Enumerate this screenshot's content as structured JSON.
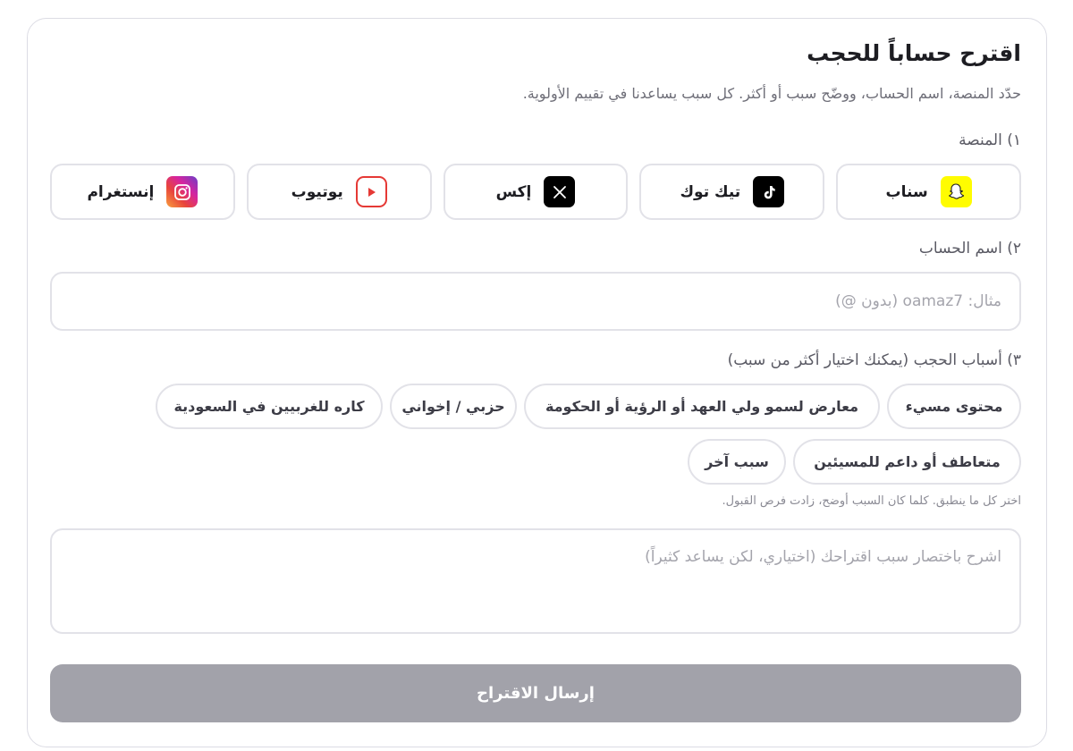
{
  "form": {
    "title": "اقترح حساباً للحجب",
    "subtitle": "حدّد المنصة، اسم الحساب، ووضّح سبب أو أكثر. كل سبب يساعدنا في تقييم الأولوية."
  },
  "platform_section": {
    "label": "١) المنصة",
    "options": [
      {
        "label": "سناب",
        "icon": "snapchat-icon",
        "color": "#fffc00"
      },
      {
        "label": "تيك توك",
        "icon": "tiktok-icon",
        "color": "#000000"
      },
      {
        "label": "إكس",
        "icon": "x-icon",
        "color": "#000000"
      },
      {
        "label": "يوتيوب",
        "icon": "youtube-icon",
        "color": "#e53935"
      },
      {
        "label": "إنستغرام",
        "icon": "instagram-icon",
        "color": "#d6249f"
      }
    ]
  },
  "account_section": {
    "label": "٢) اسم الحساب",
    "placeholder": "مثال: oamaz7 (بدون @)",
    "value": ""
  },
  "reasons_section": {
    "label": "٣) أسباب الحجب (يمكنك اختيار أكثر من سبب)",
    "reasons": [
      "محتوى مسيء",
      "معارض لسمو ولي العهد أو الرؤية أو الحكومة",
      "حزبي / إخواني",
      "كاره للغربيين في السعودية",
      "متعاطف أو داعم للمسيئين",
      "سبب آخر"
    ],
    "hint": "اختر كل ما ينطبق. كلما كان السبب أوضح، زادت فرص القبول."
  },
  "details": {
    "placeholder": "اشرح باختصار سبب اقتراحك (اختياري، لكن يساعد كثيراً)",
    "value": ""
  },
  "submit": {
    "label": "إرسال الاقتراح",
    "color": "#a2a2aa"
  }
}
